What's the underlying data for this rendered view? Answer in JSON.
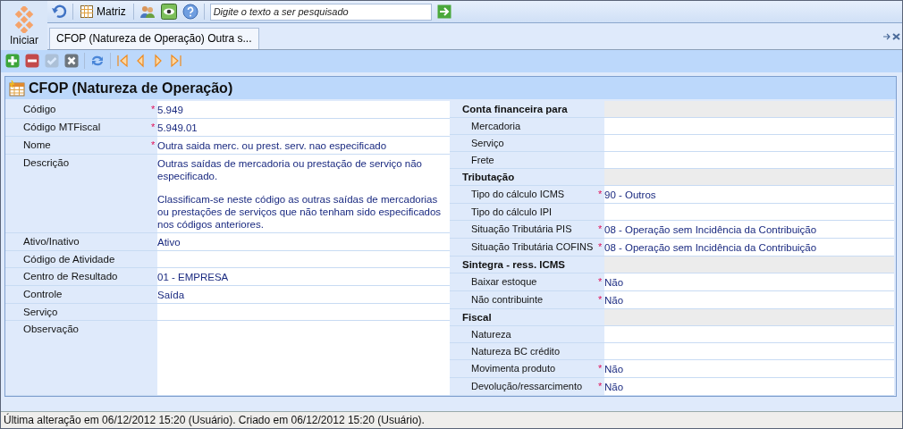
{
  "toolbar": {
    "matrix_label": "Matriz",
    "search": {
      "placeholder": "Digite o texto a ser pesquisado"
    }
  },
  "start_label": "Iniciar",
  "tabs": [
    {
      "label": "CFOP (Natureza de Operação) Outra s...",
      "selected": true
    }
  ],
  "actions": [
    {
      "kind": "add",
      "disabled": false
    },
    {
      "kind": "remove",
      "disabled": false
    },
    {
      "kind": "confirm",
      "disabled": true
    },
    {
      "kind": "cancel",
      "disabled": false
    },
    {
      "kind": "refresh",
      "disabled": false
    },
    {
      "kind": "first",
      "disabled": false
    },
    {
      "kind": "prev",
      "disabled": false
    },
    {
      "kind": "next",
      "disabled": false
    },
    {
      "kind": "last",
      "disabled": false
    }
  ],
  "form": {
    "title": "CFOP (Natureza de Operação)",
    "left": [
      {
        "label": "Código",
        "required_mark": "*",
        "value": [
          "5.949"
        ]
      },
      {
        "label": "Código MTFiscal",
        "required_mark": "*",
        "value": [
          "5.949.01"
        ]
      },
      {
        "label": "Nome",
        "required_mark": "*",
        "value": [
          "Outra saida merc. ou prest. serv. nao especificado"
        ]
      },
      {
        "label": "Descrição",
        "value": [
          "Outras saídas de mercadoria ou prestação de serviço não especificado.",
          "Classificam-se neste código as outras saídas de mercadorias ou prestações de serviços que não tenham sido especificados nos códigos anteriores."
        ]
      },
      {
        "label": "Ativo/Inativo",
        "value": [
          "Ativo"
        ]
      },
      {
        "label": "Código de Atividade"
      },
      {
        "label": "Centro de Resultado",
        "value": [
          "01 - EMPRESA"
        ]
      },
      {
        "label": "Controle",
        "value": [
          "Saída"
        ]
      },
      {
        "label": "Serviço"
      },
      {
        "label": "Observação"
      }
    ],
    "right": [
      {
        "title": "Conta financeira para",
        "rows": [
          {
            "label": "Mercadoria"
          },
          {
            "label": "Serviço"
          },
          {
            "label": "Frete"
          }
        ]
      },
      {
        "title": "Tributação",
        "rows": [
          {
            "label": "Tipo do cálculo ICMS",
            "required_mark": "*",
            "value": "90 - Outros"
          },
          {
            "label": "Tipo do cálculo IPI"
          },
          {
            "label": "Situação Tributária PIS",
            "required_mark": "*",
            "value": "08 - Operação sem Incidência da Contribuição"
          },
          {
            "label": "Situação Tributária COFINS",
            "required_mark": "*",
            "value": "08 - Operação sem Incidência da Contribuição"
          }
        ]
      },
      {
        "title": "Sintegra - ress. ICMS",
        "rows": [
          {
            "label": "Baixar estoque",
            "required_mark": "*",
            "value": "Não"
          },
          {
            "label": "Não contribuinte",
            "required_mark": "*",
            "value": "Não"
          }
        ]
      },
      {
        "title": "Fiscal",
        "rows": [
          {
            "label": "Natureza"
          },
          {
            "label": "Natureza BC crédito"
          },
          {
            "label": "Movimenta produto",
            "required_mark": "*",
            "value": "Não"
          },
          {
            "label": "Devolução/ressarcimento",
            "required_mark": "*",
            "value": "Não"
          }
        ]
      }
    ]
  },
  "status_bar": "Última alteração em 06/12/2012 15:20 (Usuário). Criado em 06/12/2012 15:20 (Usuário)."
}
